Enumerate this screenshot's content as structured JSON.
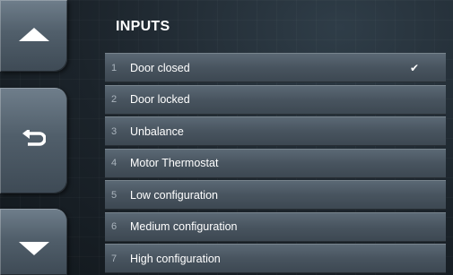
{
  "header": {
    "title": "INPUTS"
  },
  "nav": {
    "up_icon": "triangle-up-icon",
    "back_icon": "back-arrow-icon",
    "down_icon": "triangle-down-icon"
  },
  "inputs": [
    {
      "number": "1",
      "label": "Door closed",
      "checked": true,
      "check_glyph": "✔"
    },
    {
      "number": "2",
      "label": "Door locked",
      "checked": false,
      "check_glyph": ""
    },
    {
      "number": "3",
      "label": "Unbalance",
      "checked": false,
      "check_glyph": ""
    },
    {
      "number": "4",
      "label": "Motor Thermostat",
      "checked": false,
      "check_glyph": ""
    },
    {
      "number": "5",
      "label": "Low configuration",
      "checked": false,
      "check_glyph": ""
    },
    {
      "number": "6",
      "label": "Medium configuration",
      "checked": false,
      "check_glyph": ""
    },
    {
      "number": "7",
      "label": "High configuration",
      "checked": false,
      "check_glyph": ""
    }
  ],
  "colors": {
    "background": "#1b232a",
    "row": "#48545f",
    "button": "#515f6b",
    "text": "#ffffff"
  }
}
